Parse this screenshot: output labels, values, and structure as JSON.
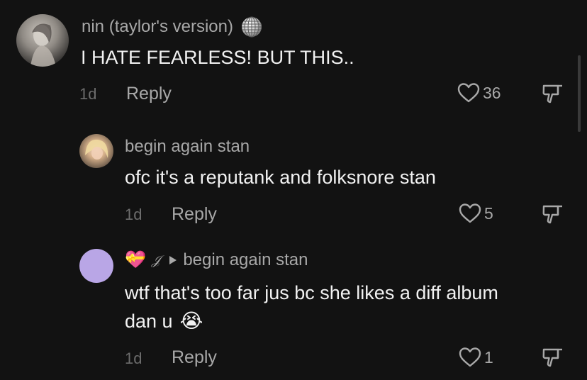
{
  "comments": [
    {
      "username": "nin (taylor's version)",
      "badge_icon": "disco-ball-icon",
      "text": "I HATE FEARLESS! BUT THIS..",
      "time": "1d",
      "reply_label": "Reply",
      "like_count": "36"
    },
    {
      "username": "begin again stan",
      "text": "ofc it's a reputank and folksnore stan",
      "time": "1d",
      "reply_label": "Reply",
      "like_count": "5"
    },
    {
      "username_emoji": "💝",
      "username": "𝒥",
      "reply_to": "begin again stan",
      "text_line1": "wtf that's too far jus bc she likes a diff album",
      "text_line2": "dan u",
      "text_emoji": "😭",
      "time": "1d",
      "reply_label": "Reply",
      "like_count": "1"
    }
  ],
  "colors": {
    "background": "#121212",
    "primary_text": "#f2f2f2",
    "secondary_text": "#a8a8a8",
    "timestamp": "#6c6c6c",
    "avatar_purple": "#b9a6e6"
  }
}
